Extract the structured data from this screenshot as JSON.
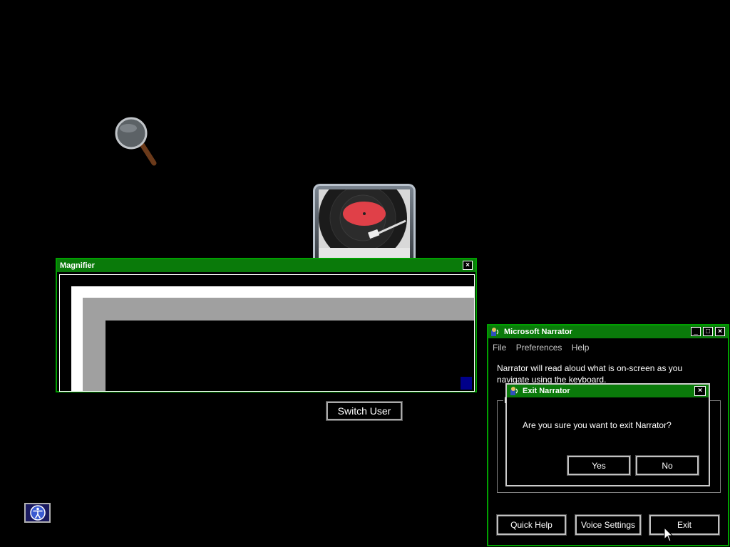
{
  "desktop": {
    "switch_user_label": "Switch User"
  },
  "magnifier": {
    "title": "Magnifier",
    "close_glyph": "×"
  },
  "narrator": {
    "title": "Microsoft Narrator",
    "menu": [
      "File",
      "Preferences",
      "Help"
    ],
    "description": "Narrator will read aloud what is on-screen as you navigate using the keyboard.",
    "group_label_fragment": "M",
    "buttons": {
      "quick_help": "Quick Help",
      "voice_settings": "Voice Settings",
      "exit": "Exit"
    },
    "minimize_glyph": "_",
    "maximize_glyph": "□",
    "close_glyph": "×"
  },
  "exit_dialog": {
    "title": "Exit Narrator",
    "message": "Are you sure you want to exit Narrator?",
    "yes_label": "Yes",
    "no_label": "No",
    "close_glyph": "×"
  },
  "colors": {
    "titlebar": "#0a7a0a",
    "window_border": "#00a000",
    "background": "#000000"
  }
}
